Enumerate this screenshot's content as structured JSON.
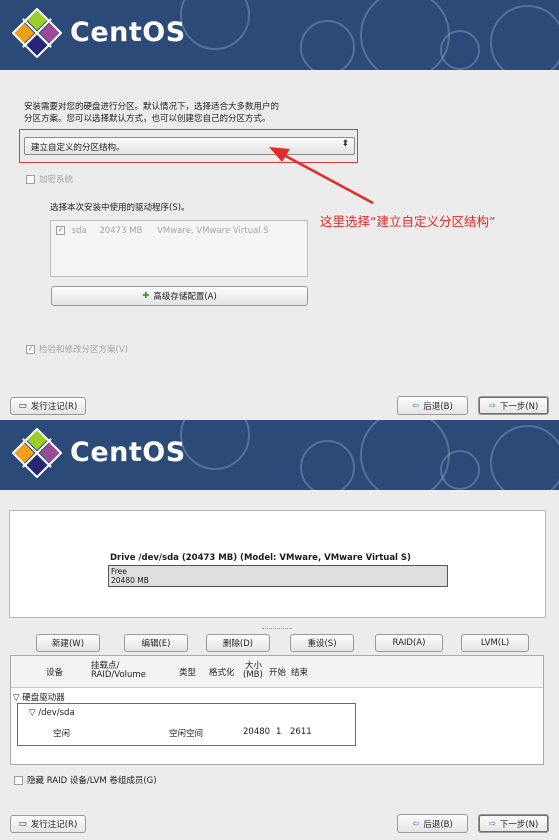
{
  "brand": {
    "logo_text": "CentOS"
  },
  "screen1": {
    "intro_line1": "安装需要对您的硬盘进行分区。默认情况下，选择适合大多数用户的",
    "intro_line2": "分区方案。您可以选择默认方式，也可以创建您自己的分区方式。",
    "partition_select": "建立自定义的分区结构。",
    "encrypt_label": "加密系统",
    "drivers_label": "选择本次安装中使用的驱动程序(S)。",
    "drive_row": {
      "name": "sda",
      "size": "20473 MB",
      "model": "VMware, VMware Virtual S"
    },
    "advanced_storage_button": "高级存储配置(A)",
    "review_label": "检验和修改分区方案(V)",
    "annotation": "这里选择“建立自定义分区结构”",
    "release_notes_button": "发行注记(R)",
    "back_button": "后退(B)",
    "next_button": "下一步(N)"
  },
  "screen2": {
    "drive_title": "Drive /dev/sda (20473 MB) (Model: VMware, VMware Virtual S)",
    "free_label": "Free",
    "free_size": "20480 MB",
    "toolbar": {
      "new": "新建(W)",
      "edit": "编辑(E)",
      "delete": "删除(D)",
      "reset": "重设(S)",
      "raid": "RAID(A)",
      "lvm": "LVM(L)"
    },
    "columns": {
      "device": "设备",
      "mount1": "挂载点/",
      "mount2": "RAID/Volume",
      "type": "类型",
      "format": "格式化",
      "size1": "大小",
      "size2": "(MB)",
      "start": "开始",
      "end": "结束"
    },
    "tree": {
      "group": "硬盘驱动器",
      "device": "/dev/sda",
      "row": {
        "name": "空闲",
        "type": "空闲空间",
        "size": "20480",
        "start": "1",
        "end": "2611"
      }
    },
    "hide_raid_label": "隐藏 RAID 设备/LVM 卷组成员(G)",
    "release_notes_button": "发行注记(R)",
    "back_button": "后退(B)",
    "next_button": "下一步(N)"
  }
}
